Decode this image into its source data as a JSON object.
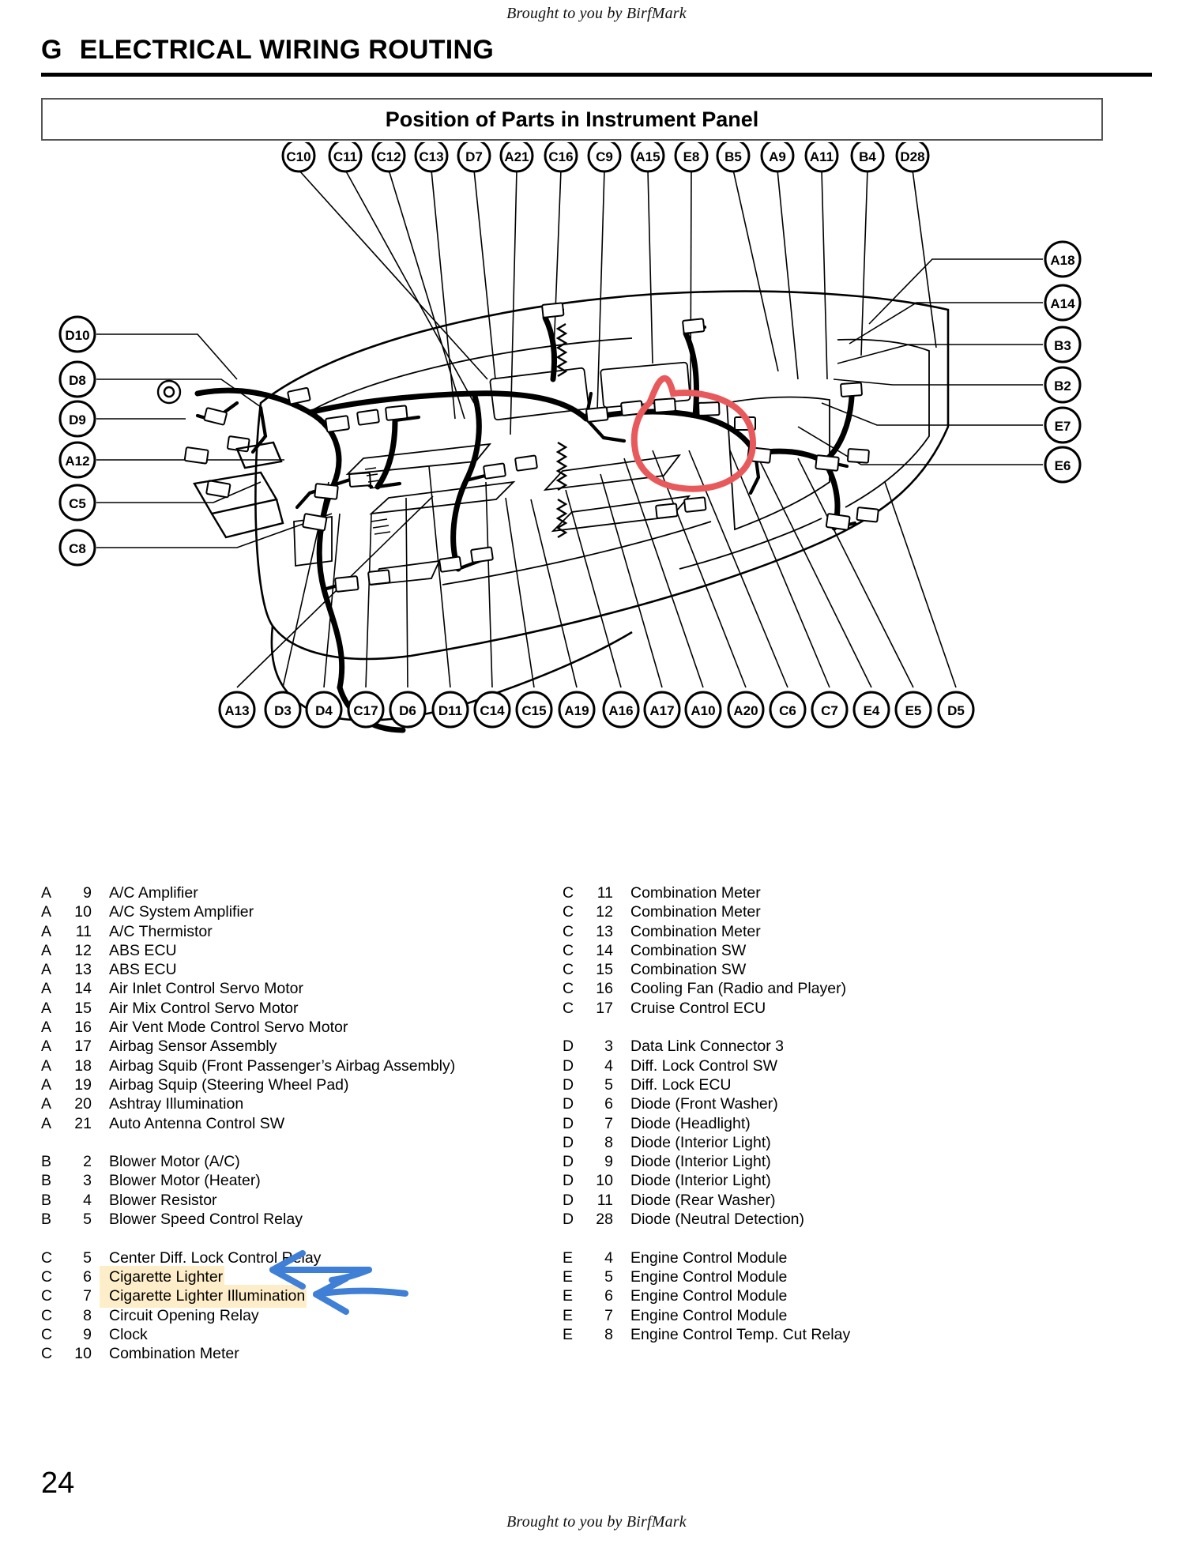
{
  "watermark": {
    "top": "Brought to you by BirfMark",
    "bottom": "Brought to you by BirfMark"
  },
  "header": {
    "section_letter": "G",
    "section_title": "ELECTRICAL WIRING ROUTING"
  },
  "subtitle": "Position of Parts in Instrument Panel",
  "page_number": "24",
  "colors": {
    "highlight": "#fdeec9",
    "annotation_arrow": "#3f7fd6",
    "annotation_circle": "#e8595c",
    "rule": "#000000"
  },
  "diagram": {
    "callouts_top": [
      "C10",
      "C11",
      "C12",
      "C13",
      "D7",
      "A21",
      "C16",
      "C9",
      "A15",
      "E8",
      "B5",
      "A9",
      "A11",
      "B4",
      "D28"
    ],
    "callouts_left": [
      "D10",
      "D8",
      "D9",
      "A12",
      "C5",
      "C8"
    ],
    "callouts_right": [
      "A18",
      "A14",
      "B3",
      "B2",
      "E7",
      "E6"
    ],
    "callouts_bottom": [
      "A13",
      "D3",
      "D4",
      "C17",
      "D6",
      "D11",
      "C14",
      "C15",
      "A19",
      "A16",
      "A17",
      "A10",
      "A20",
      "C6",
      "C7",
      "E4",
      "E5",
      "D5"
    ]
  },
  "legend_left": [
    {
      "letter": "A",
      "num": "9",
      "name": "A/C Amplifier"
    },
    {
      "letter": "A",
      "num": "10",
      "name": "A/C System Amplifier"
    },
    {
      "letter": "A",
      "num": "11",
      "name": "A/C Thermistor"
    },
    {
      "letter": "A",
      "num": "12",
      "name": "ABS ECU"
    },
    {
      "letter": "A",
      "num": "13",
      "name": "ABS ECU"
    },
    {
      "letter": "A",
      "num": "14",
      "name": "Air Inlet Control Servo Motor"
    },
    {
      "letter": "A",
      "num": "15",
      "name": "Air Mix Control Servo Motor"
    },
    {
      "letter": "A",
      "num": "16",
      "name": "Air Vent Mode Control Servo Motor"
    },
    {
      "letter": "A",
      "num": "17",
      "name": "Airbag Sensor Assembly"
    },
    {
      "letter": "A",
      "num": "18",
      "name": "Airbag Squib (Front Passenger’s Airbag Assembly)"
    },
    {
      "letter": "A",
      "num": "19",
      "name": "Airbag Squip (Steering Wheel Pad)"
    },
    {
      "letter": "A",
      "num": "20",
      "name": "Ashtray Illumination"
    },
    {
      "letter": "A",
      "num": "21",
      "name": "Auto Antenna Control SW"
    },
    {
      "spacer": true
    },
    {
      "letter": "B",
      "num": "2",
      "name": "Blower Motor (A/C)"
    },
    {
      "letter": "B",
      "num": "3",
      "name": "Blower Motor (Heater)"
    },
    {
      "letter": "B",
      "num": "4",
      "name": "Blower Resistor"
    },
    {
      "letter": "B",
      "num": "5",
      "name": "Blower Speed Control Relay"
    },
    {
      "spacer": true
    },
    {
      "letter": "C",
      "num": "5",
      "name": "Center Diff. Lock Control Relay"
    },
    {
      "letter": "C",
      "num": "6",
      "name": "Cigarette Lighter",
      "highlight": true
    },
    {
      "letter": "C",
      "num": "7",
      "name": "Cigarette Lighter Illumination",
      "highlight": true
    },
    {
      "letter": "C",
      "num": "8",
      "name": "Circuit Opening Relay"
    },
    {
      "letter": "C",
      "num": "9",
      "name": "Clock"
    },
    {
      "letter": "C",
      "num": "10",
      "name": "Combination Meter"
    }
  ],
  "legend_right": [
    {
      "letter": "C",
      "num": "11",
      "name": "Combination Meter"
    },
    {
      "letter": "C",
      "num": "12",
      "name": "Combination Meter"
    },
    {
      "letter": "C",
      "num": "13",
      "name": "Combination Meter"
    },
    {
      "letter": "C",
      "num": "14",
      "name": "Combination SW"
    },
    {
      "letter": "C",
      "num": "15",
      "name": "Combination SW"
    },
    {
      "letter": "C",
      "num": "16",
      "name": "Cooling Fan (Radio and Player)"
    },
    {
      "letter": "C",
      "num": "17",
      "name": "Cruise Control ECU"
    },
    {
      "spacer": true
    },
    {
      "letter": "D",
      "num": "3",
      "name": "Data Link Connector 3"
    },
    {
      "letter": "D",
      "num": "4",
      "name": "Diff. Lock Control SW"
    },
    {
      "letter": "D",
      "num": "5",
      "name": "Diff. Lock ECU"
    },
    {
      "letter": "D",
      "num": "6",
      "name": "Diode (Front Washer)"
    },
    {
      "letter": "D",
      "num": "7",
      "name": "Diode (Headlight)"
    },
    {
      "letter": "D",
      "num": "8",
      "name": "Diode (Interior Light)"
    },
    {
      "letter": "D",
      "num": "9",
      "name": "Diode (Interior Light)"
    },
    {
      "letter": "D",
      "num": "10",
      "name": "Diode (Interior Light)"
    },
    {
      "letter": "D",
      "num": "11",
      "name": "Diode (Rear Washer)"
    },
    {
      "letter": "D",
      "num": "28",
      "name": "Diode (Neutral Detection)"
    },
    {
      "spacer": true
    },
    {
      "letter": "E",
      "num": "4",
      "name": "Engine Control Module"
    },
    {
      "letter": "E",
      "num": "5",
      "name": "Engine Control Module"
    },
    {
      "letter": "E",
      "num": "6",
      "name": "Engine Control Module"
    },
    {
      "letter": "E",
      "num": "7",
      "name": "Engine Control Module"
    },
    {
      "letter": "E",
      "num": "8",
      "name": "Engine Control Temp. Cut Relay"
    }
  ]
}
